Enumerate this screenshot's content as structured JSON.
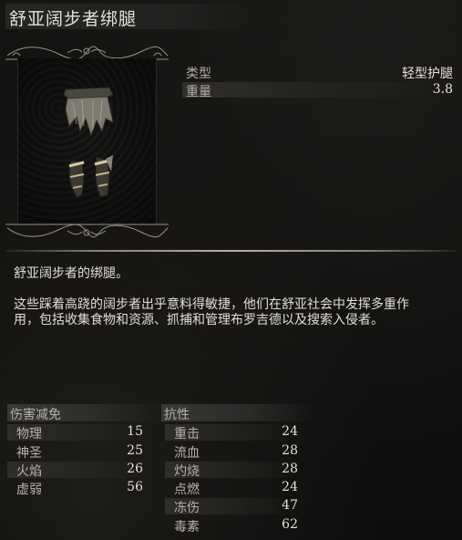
{
  "item": {
    "name": "舒亚阔步者绑腿",
    "type_label": "类型",
    "type_value": "轻型护腿",
    "weight_label": "重量",
    "weight_value": "3.8"
  },
  "description": {
    "line1": "舒亚阔步者的绑腿。",
    "line2": "这些踩着高跷的阔步者出乎意料得敏捷，他们在舒亚社会中发挥多重作",
    "line3": "用，包括收集食物和资源、抓捕和管理布罗吉德以及搜索入侵者。"
  },
  "damage_reduction": {
    "title": "伤害减免",
    "rows": [
      {
        "label": "物理",
        "value": "15"
      },
      {
        "label": "神圣",
        "value": "25"
      },
      {
        "label": "火焰",
        "value": "26"
      },
      {
        "label": "虚弱",
        "value": "56"
      }
    ]
  },
  "resistance": {
    "title": "抗性",
    "rows": [
      {
        "label": "重击",
        "value": "24"
      },
      {
        "label": "流血",
        "value": "28"
      },
      {
        "label": "灼烧",
        "value": "28"
      },
      {
        "label": "点燃",
        "value": "24"
      },
      {
        "label": "冻伤",
        "value": "47"
      },
      {
        "label": "毒素",
        "value": "62"
      }
    ]
  },
  "colors": {
    "background": "#0f0f0e",
    "text": "#e4e0d6",
    "label": "#b8b3a8",
    "divider": "#b9b09c"
  }
}
